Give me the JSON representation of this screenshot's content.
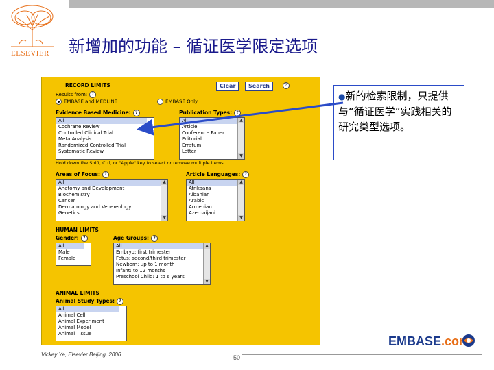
{
  "slide": {
    "title": "新增加的功能 – 循证医学限定选项",
    "publisher": "ELSEVIER",
    "footer_author": "Vickey Ye, Elsevier Beijing, 2006",
    "page_number": "50",
    "brand": "EMBASE",
    "brand_suffix": ".com"
  },
  "callout": {
    "text": "新的检索限制，只提供与“循证医学”实践相关的研究类型选项。"
  },
  "form": {
    "record_limits_heading": "RECORD LIMITS",
    "clear_label": "Clear",
    "search_label": "Search",
    "results_from_label": "Results from:",
    "radio_options": [
      {
        "label": "EMBASE and MEDLINE",
        "selected": true
      },
      {
        "label": "EMBASE Only",
        "selected": false
      }
    ],
    "ebm_label": "Evidence Based Medicine:",
    "ebm_options": [
      "All",
      "Cochrane Review",
      "Controlled Clinical Trial",
      "Meta Analysis",
      "Randomized Controlled Trial",
      "Systematic Review"
    ],
    "pubtypes_label": "Publication Types:",
    "pubtypes_options": [
      "All",
      "Article",
      "Conference Paper",
      "Editorial",
      "Erratum",
      "Letter"
    ],
    "hold_hint": "Hold down the Shift, Ctrl, or \"Apple\" key to select or remove multiple items",
    "focus_label": "Areas of Focus:",
    "focus_options": [
      "All",
      "Anatomy and Development",
      "Biochemistry",
      "Cancer",
      "Dermatology and Venereology",
      "Genetics"
    ],
    "languages_label": "Article Languages:",
    "languages_options": [
      "All",
      "Afrikaans",
      "Albanian",
      "Arabic",
      "Armenian",
      "Azerbaijani"
    ],
    "human_limits_heading": "HUMAN LIMITS",
    "gender_label": "Gender:",
    "gender_options": [
      "All",
      "Male",
      "Female"
    ],
    "age_label": "Age Groups:",
    "age_options": [
      "All",
      "Embryo: first trimester",
      "Fetus: second/third trimester",
      "Newborn: up to 1 month",
      "Infant: to 12 months",
      "Preschool Child: 1 to 6 years"
    ],
    "animal_limits_heading": "ANIMAL LIMITS",
    "animal_label": "Animal Study Types:",
    "animal_options": [
      "All",
      "Animal Cell",
      "Animal Experiment",
      "Animal Model",
      "Animal Tissue"
    ]
  },
  "colors": {
    "panel": "#f5c400",
    "title": "#1a1a8c",
    "callout_border": "#2b4cc8",
    "arrow": "#2b4cc8",
    "logo": "#e8701a"
  }
}
